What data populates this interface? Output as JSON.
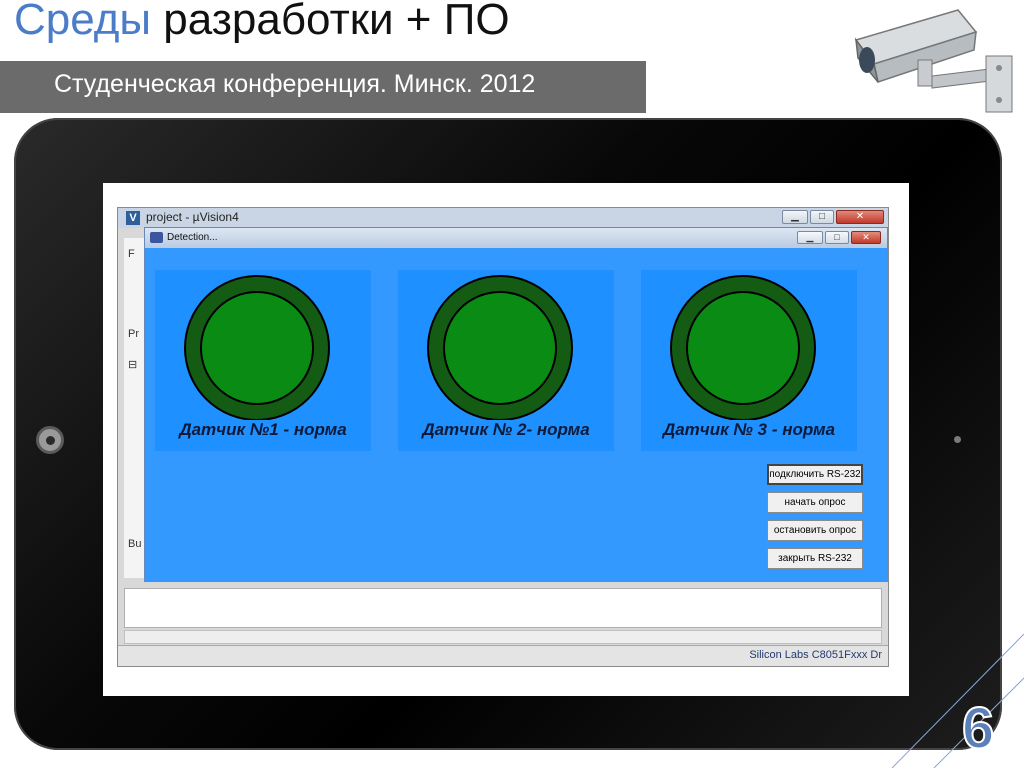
{
  "slide": {
    "title_accent": "Среды",
    "title_rest": "разработки + ПО",
    "subtitle": "Студенческая конференция.  Минск. 2012",
    "page_number": "6"
  },
  "uvision": {
    "title": "project - µVision4",
    "status_text": "Silicon Labs C8051Fxxx Dr",
    "left_labels": [
      "F",
      "Pr",
      "⊟",
      "Bu"
    ]
  },
  "detection": {
    "title": "Detection...",
    "sensors": [
      {
        "label": "Датчик №1 - норма",
        "status_color": "#0a8c14"
      },
      {
        "label": "Датчик № 2- норма",
        "status_color": "#0a8c14"
      },
      {
        "label": "Датчик № 3 - норма",
        "status_color": "#0a8c14"
      }
    ],
    "buttons": {
      "connect": "подключить RS-232",
      "start": "начать опрос",
      "stop": "остановить опрос",
      "close": "закрыть  RS-232"
    }
  },
  "colors": {
    "title_accent": "#4a7cc8",
    "banner": "#6b6b6b",
    "detection_bg": "#3399ff",
    "panel_bg": "#1e90ff",
    "indicator_ring": "#145c14",
    "indicator_fill": "#0a8c14"
  },
  "icons": [
    "camera-icon",
    "minimize-icon",
    "maximize-icon",
    "close-icon",
    "app-icon"
  ]
}
